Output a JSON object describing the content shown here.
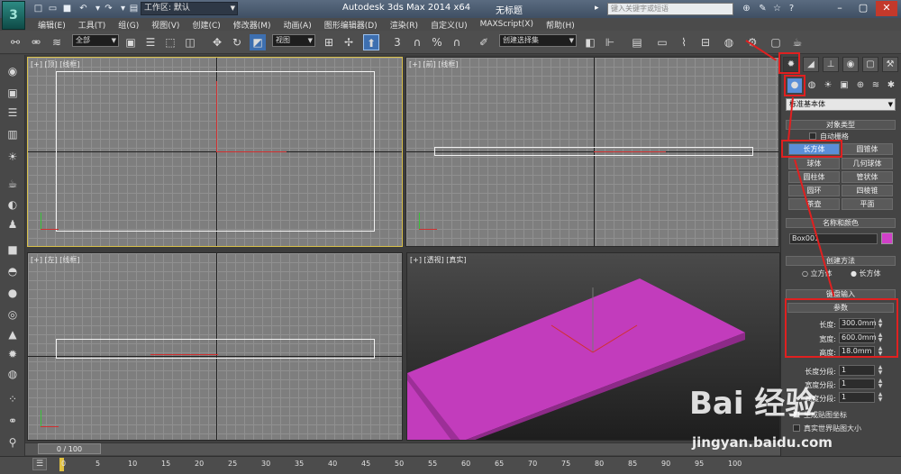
{
  "titlebar": {
    "app_title": "Autodesk 3ds Max  2014 x64",
    "doc_title": "无标题",
    "workspace": "工作区: 默认",
    "search_placeholder": "键入关键字或短语",
    "logo_glyph": "3"
  },
  "menu": [
    "编辑(E)",
    "工具(T)",
    "组(G)",
    "视图(V)",
    "创建(C)",
    "修改器(M)",
    "动画(A)",
    "图形编辑器(D)",
    "渲染(R)",
    "自定义(U)",
    "MAXScript(X)",
    "帮助(H)"
  ],
  "toolbar": {
    "selection_filter": "全部",
    "ref_coord": "视图",
    "named_selection": "创建选择集",
    "snap_label": "3"
  },
  "viewports": {
    "top": "[+] [顶] [线框]",
    "front": "[+] [前] [线框]",
    "left": "[+] [左] [线框]",
    "perspective": "[+] [透视] [真实]"
  },
  "timeline": {
    "slider": "0 / 100",
    "ticks": [
      "0",
      "5",
      "10",
      "15",
      "20",
      "25",
      "30",
      "35",
      "40",
      "45",
      "50",
      "55",
      "60",
      "65",
      "70",
      "75",
      "80",
      "85",
      "90",
      "95",
      "100"
    ]
  },
  "command_panel": {
    "primitive_type": "标准基本体",
    "rollouts": {
      "object_type": "对象类型",
      "name_color": "名称和颜色",
      "creation_method": "创建方法",
      "keyboard_entry": "键盘输入",
      "parameters": "参数"
    },
    "autogrid": "自动栅格",
    "object_buttons": [
      "长方体",
      "圆锥体",
      "球体",
      "几何球体",
      "圆柱体",
      "管状体",
      "圆环",
      "四棱锥",
      "茶壶",
      "平面"
    ],
    "object_name": "Box001",
    "object_color": "#d040c8",
    "creation": [
      "立方体",
      "长方体"
    ],
    "params": [
      {
        "label": "长度:",
        "value": "300.0mm"
      },
      {
        "label": "宽度:",
        "value": "600.0mm"
      },
      {
        "label": "高度:",
        "value": "18.0mm"
      }
    ],
    "segments": [
      {
        "label": "长度分段:",
        "value": "1"
      },
      {
        "label": "宽度分段:",
        "value": "1"
      },
      {
        "label": "高度分段:",
        "value": "1"
      }
    ],
    "gen_mapping": "生成贴图坐标",
    "real_world": "真实世界贴图大小"
  },
  "watermark": {
    "logo": "Bai 经验",
    "url": "jingyan.baidu.com"
  },
  "colors": {
    "box": "#c23cbc",
    "accent": "#5a8fd8",
    "annotation": "#e02020"
  }
}
